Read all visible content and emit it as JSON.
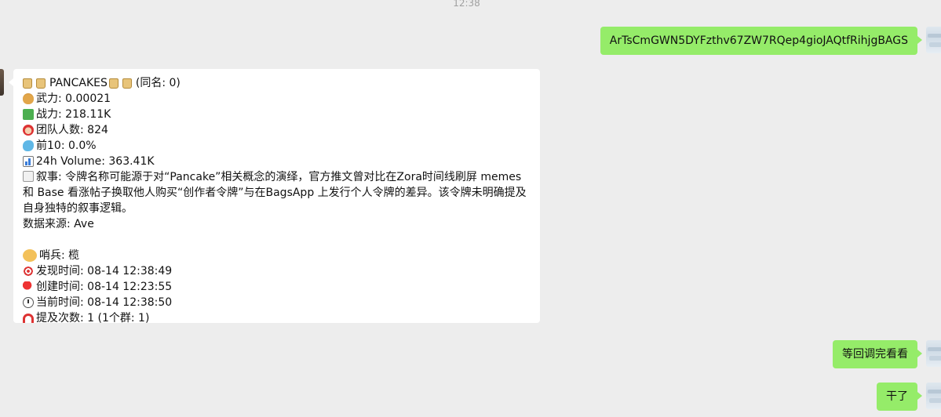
{
  "chat": {
    "timestamp": "12:38",
    "messages_out": [
      {
        "text": "ArTsCmGWN5DYFzthv67ZW7RQep4gioJAQtfRihjgBAGS"
      },
      {
        "text": "等回调完看看"
      },
      {
        "text": "干了"
      }
    ],
    "card": {
      "title": "PANCAKES",
      "same_name": "(同名: 0)",
      "wuli": "武力: 0.00021",
      "zhanli": "战力: 218.11K",
      "team": "团队人数: 824",
      "top10": "前10: 0.0%",
      "volume": "24h Volume: 363.41K",
      "narrative": "叙事: 令牌名称可能源于对“Pancake”相关概念的演绎，官方推文曾对比在Zora时间线刷屏 memes 和 Base 看涨帖子换取他人购买“创作者令牌”与在BagsApp 上发行个人令牌的差异。该令牌未明确提及自身独特的叙事逻辑。",
      "source": "数据来源: Ave",
      "sentinel": "哨兵: 榄",
      "found": "发现时间: 08-14 12:38:49",
      "created": "创建时间: 08-14 12:23:55",
      "now": "当前时间: 08-14 12:38:50",
      "mentions": "提及次数: 1 (1个群: 1)"
    },
    "icons": {
      "title": "scroll-icon",
      "wuli": "money-bag-icon",
      "zhanli": "chart-up-icon",
      "team": "santa-icon",
      "top10": "whale-icon",
      "volume": "bar-chart-icon",
      "narrative": "memo-icon",
      "sentinel": "cat-face-icon",
      "found": "target-icon",
      "created": "pushpin-icon",
      "now": "clock-icon",
      "mentions": "magnet-icon"
    },
    "colors": {
      "background": "#ededed",
      "outgoing_bubble": "#95ec69",
      "incoming_bubble": "#ffffff"
    }
  }
}
